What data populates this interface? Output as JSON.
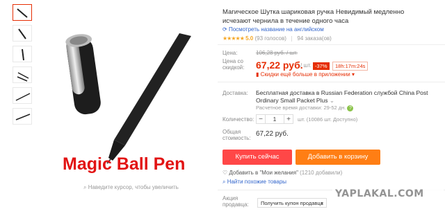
{
  "product": {
    "title": "Магическое Шутка шариковая ручка Невидимый медленно исчезают чернила в течение одного часа",
    "translate_link": "Посмотреть название на английском",
    "rating_value": "5.0",
    "rating_votes": "(93 голосов)",
    "orders": "94 заказа(ов)",
    "image_caption": "Magic Ball Pen",
    "zoom_hint": "Наведите курсор, чтобы увеличить"
  },
  "price": {
    "label_price": "Цена:",
    "label_discount": "Цена со скидкой:",
    "old": "106,28 руб. / шт.",
    "current": "67,22 руб.",
    "per_unit": "/ шт.",
    "discount": "-37%",
    "timer": "18h:17m:24s",
    "app_discount": "Скидки ещё больше в приложении"
  },
  "shipping": {
    "label": "Доставка:",
    "text": "Бесплатная доставка в Russian Federation службой China Post Ordinary Small Packet Plus",
    "eta": "Расчетное время доставки: 29-52 дн."
  },
  "quantity": {
    "label": "Количество:",
    "value": "1",
    "unit": "шт. (10086 шт. Доступно)"
  },
  "total": {
    "label": "Общая стоимость:",
    "value": "67,22 руб."
  },
  "actions": {
    "buy": "Купить сейчас",
    "cart": "Добавить в корзину",
    "wishlist": "Добавить в \"Мои желания\"",
    "wishlist_count": "(1210 добавили)",
    "similar": "Найти похожие товары"
  },
  "promo": {
    "label": "Акция продавца:",
    "select": "Получить купон продавца"
  },
  "watermark": "YAPLAKAL.COM",
  "colors": {
    "accent": "#e62e04",
    "buy": "#ff4747",
    "cart": "#ff7e14",
    "link": "#3366cc",
    "star": "#f5a623"
  }
}
